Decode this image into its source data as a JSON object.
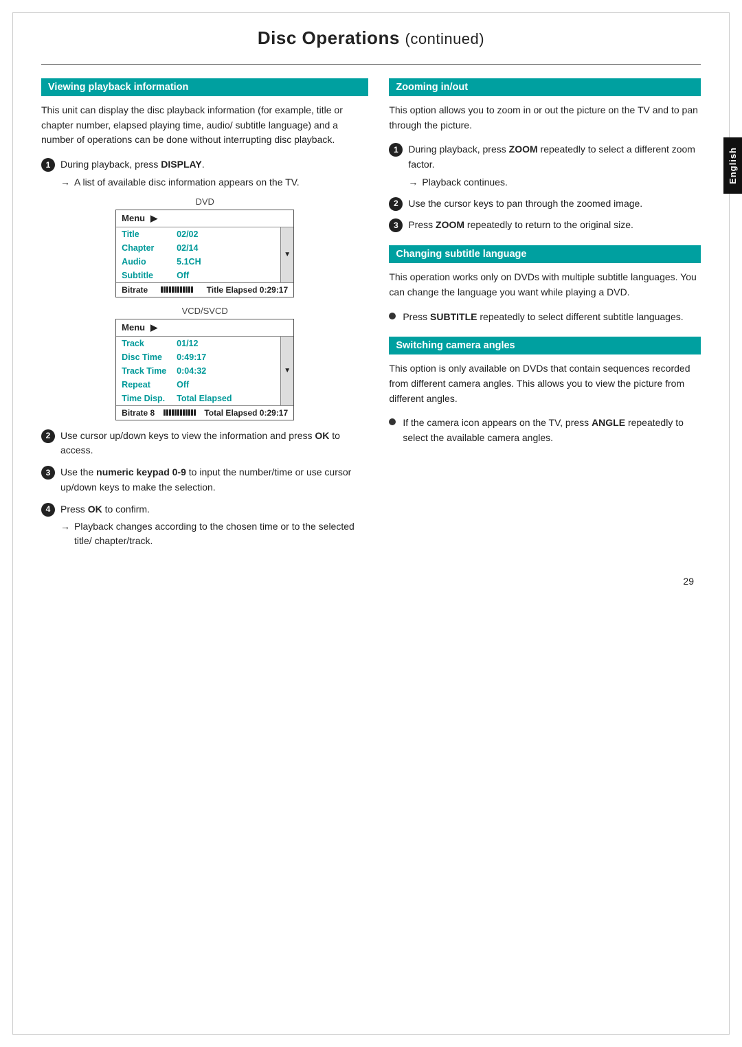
{
  "page": {
    "title": "Disc Operations",
    "title_continued": "continued",
    "page_number": "29",
    "english_tab": "English"
  },
  "left_column": {
    "section1": {
      "header": "Viewing playback information",
      "body": "This unit can display the disc playback information (for example, title or chapter number, elapsed playing time, audio/ subtitle language) and a number of operations can be done without interrupting disc playback.",
      "step1": {
        "num": "1",
        "text_before": "During playback, press ",
        "key": "DISPLAY",
        "text_after": ".",
        "arrow": "A list of available disc information appears on the TV."
      },
      "dvd_label": "DVD",
      "dvd_menu": {
        "title": "Menu",
        "rows": [
          {
            "label": "Title",
            "value": "02/02"
          },
          {
            "label": "Chapter",
            "value": "02/14"
          },
          {
            "label": "Audio",
            "value": "5.1CH"
          },
          {
            "label": "Subtitle",
            "value": "Off"
          }
        ],
        "bitrate_label": "Bitrate",
        "bitrate_elapsed": "Title Elapsed",
        "bitrate_time": "0:29:17"
      },
      "vcd_label": "VCD/SVCD",
      "vcd_menu": {
        "title": "Menu",
        "rows": [
          {
            "label": "Track",
            "value": "01/12"
          },
          {
            "label": "Disc Time",
            "value": "0:49:17"
          },
          {
            "label": "Track Time",
            "value": "0:04:32"
          },
          {
            "label": "Repeat",
            "value": "Off"
          },
          {
            "label": "Time Disp.",
            "value": "Total Elapsed"
          }
        ],
        "bitrate_label": "Bitrate 8",
        "bitrate_elapsed": "Total Elapsed",
        "bitrate_time": "0:29:17"
      },
      "step2": {
        "num": "2",
        "text": "Use cursor up/down keys to view the information and press ",
        "key": "OK",
        "text_after": " to access."
      },
      "step3": {
        "num": "3",
        "text_before": "Use the ",
        "key": "numeric keypad 0-9",
        "text_after": " to input the number/time or use cursor up/down keys to make the selection."
      },
      "step4": {
        "num": "4",
        "text_before": "Press ",
        "key": "OK",
        "text_after": " to confirm.",
        "arrow": "Playback changes according to the chosen time or to the selected title/ chapter/track."
      }
    }
  },
  "right_column": {
    "section1": {
      "header": "Zooming in/out",
      "body": "This option allows you to zoom in or out the picture on the TV and to pan through the picture.",
      "step1": {
        "num": "1",
        "text_before": "During playback, press ",
        "key": "ZOOM",
        "text_after": " repeatedly to select a different zoom factor.",
        "arrow": "Playback continues."
      },
      "step2": {
        "num": "2",
        "text": "Use the cursor keys to pan through the zoomed image."
      },
      "step3": {
        "num": "3",
        "text_before": "Press ",
        "key": "ZOOM",
        "text_after": " repeatedly to return to the original size."
      }
    },
    "section2": {
      "header": "Changing subtitle language",
      "body": "This operation works only on DVDs with multiple subtitle languages. You can change the language you want while playing a DVD.",
      "bullet1": {
        "text_before": "Press ",
        "key": "SUBTITLE",
        "text_after": " repeatedly to select different subtitle languages."
      }
    },
    "section3": {
      "header": "Switching camera angles",
      "body": "This option is only available on DVDs that contain sequences recorded from different camera angles. This allows you to view the picture from different angles.",
      "bullet1": {
        "text_before": "If the camera icon appears on the TV, press ",
        "key": "ANGLE",
        "text_after": " repeatedly to select the available camera angles."
      }
    }
  }
}
